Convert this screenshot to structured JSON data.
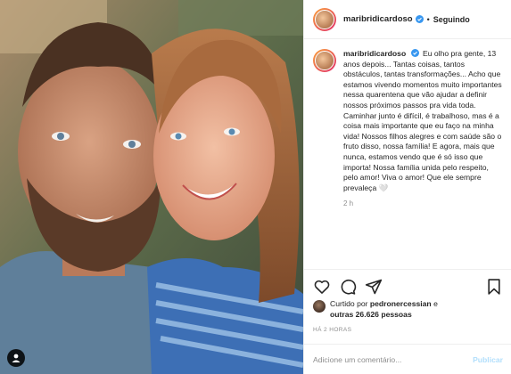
{
  "header": {
    "username": "maribridicardoso",
    "separator": "•",
    "follow_state": "Seguindo"
  },
  "caption": {
    "username": "maribridicardoso",
    "text": "Eu olho pra gente, 13 anos depois... Tantas coisas, tantos obstáculos, tantas transformações... Acho que estamos vivendo momentos muito importantes nessa quarentena que vão ajudar a definir nossos próximos passos pra vida toda. Caminhar junto é difícil, é trabalhoso, mas é a coisa mais importante que eu faço na minha vida! Nossos filhos alegres e com saúde são o fruto disso, nossa família! E agora, mais que nunca, estamos vendo que é só isso que importa! Nossa família unida pelo respeito, pelo amor! Viva o amor! Que ele sempre prevaleça 🤍",
    "time": "2 h"
  },
  "actions": {
    "icons": [
      "heart-icon",
      "comment-icon",
      "share-icon",
      "bookmark-icon"
    ]
  },
  "likes": {
    "prefix": "Curtido por",
    "liker": "pedronercessian",
    "conjunction": "e",
    "others": "outras 26.626 pessoas"
  },
  "post_age": "HÁ 2 HORAS",
  "comment": {
    "placeholder": "Adicione um comentário...",
    "publish_label": "Publicar"
  },
  "colors": {
    "verified": "#3897f0",
    "secondary_text": "#8e8e8e",
    "publish_disabled": "#b2dffc"
  }
}
